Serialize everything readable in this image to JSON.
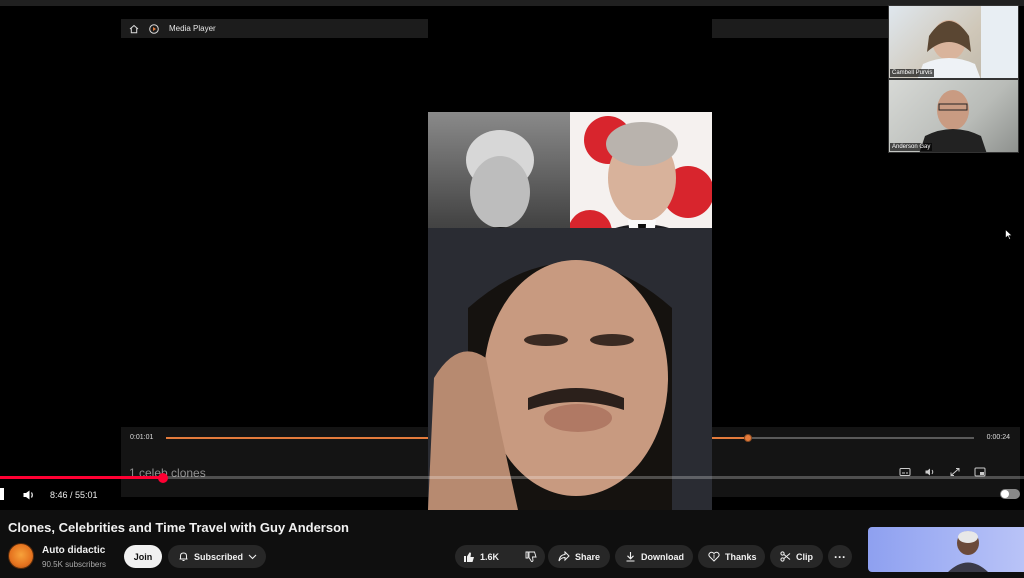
{
  "media_player": {
    "title": "Media Player",
    "time_elapsed": "0:01:01",
    "time_remaining": "0:00:24",
    "progress": 0.72,
    "caption": "1 celeb clones"
  },
  "youtube_player": {
    "time_display": "8:46 / 55:01",
    "progress": 0.159
  },
  "participants": [
    {
      "name": "Cambell Purvis"
    },
    {
      "name": "Anderson Gay"
    }
  ],
  "video": {
    "title": "Clones, Celebrities and Time Travel with Guy Anderson"
  },
  "channel": {
    "name": "Auto didactic",
    "subscribers": "90.5K subscribers",
    "join_label": "Join",
    "subscribed_label": "Subscribed"
  },
  "actions": {
    "like_count": "1.6K",
    "share_label": "Share",
    "download_label": "Download",
    "thanks_label": "Thanks",
    "clip_label": "Clip",
    "more_label": "···"
  },
  "colors": {
    "accent_red": "#ff0033",
    "media_player_accent": "#e37b3c",
    "background": "#0f0f0f"
  }
}
